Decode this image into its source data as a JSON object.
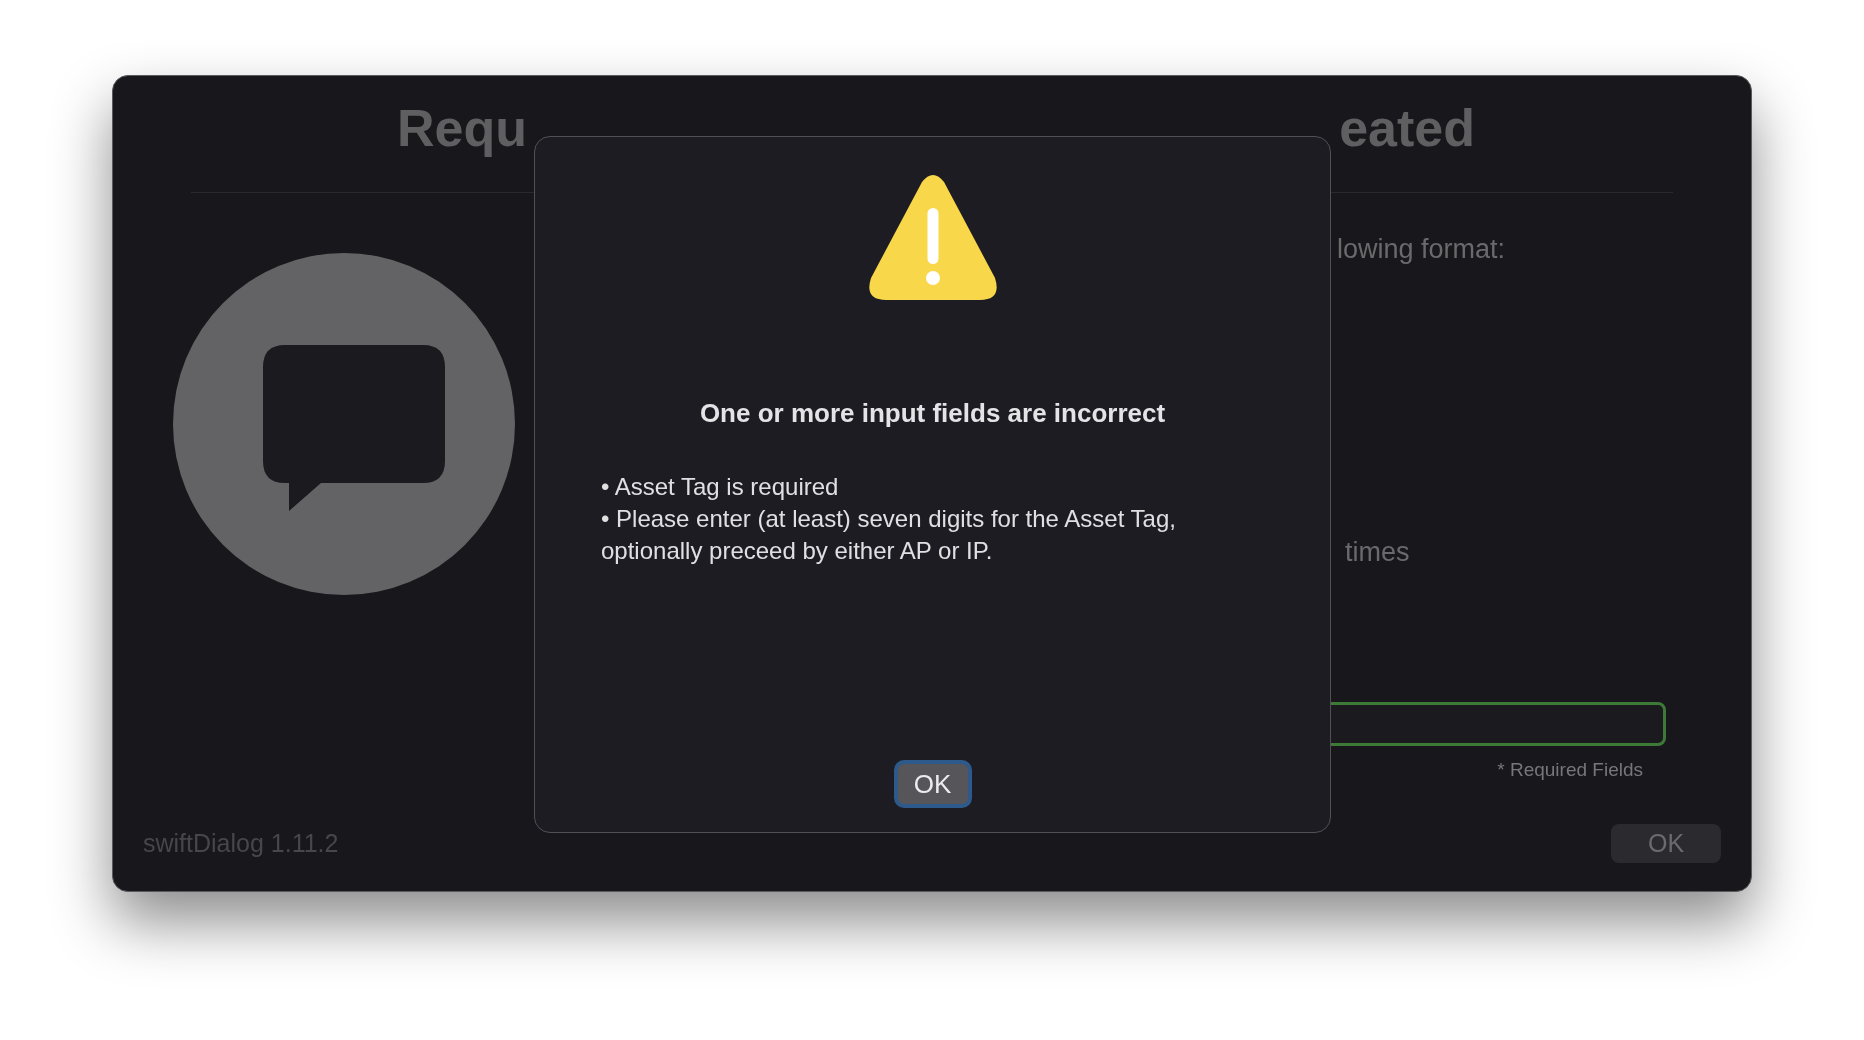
{
  "window": {
    "title_parts": [
      "Requ",
      "eated"
    ],
    "message_lines": [
      "lowing format:",
      "times"
    ],
    "field": {
      "highlighted": true
    },
    "required_note": "* Required Fields",
    "footer": "swiftDialog 1.11.2",
    "button": "OK"
  },
  "alert": {
    "heading": "One or more input fields are incorrect",
    "lines": [
      "• Asset Tag is required",
      "• Please enter (at least) seven digits for the Asset Tag,",
      "optionally preceed by either AP or IP."
    ],
    "button": {
      "label": "OK",
      "focused": true
    }
  }
}
